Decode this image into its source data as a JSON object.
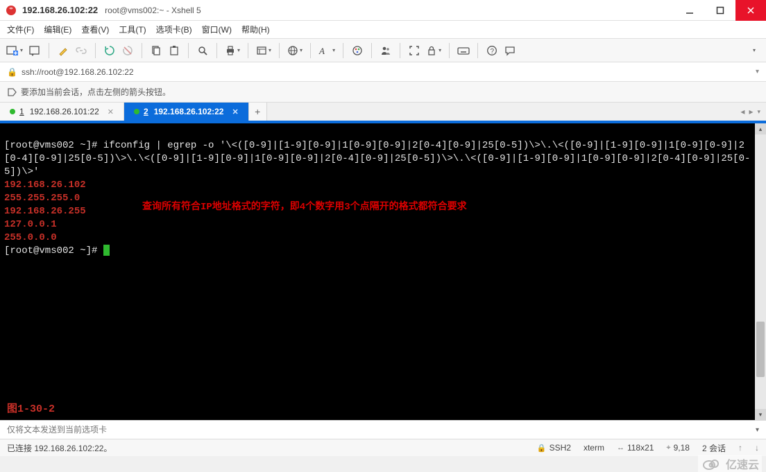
{
  "window": {
    "title_ip": "192.168.26.102:22",
    "subtitle": "root@vms002:~ - Xshell 5"
  },
  "menu": {
    "file": "文件(F)",
    "edit": "编辑(E)",
    "view": "查看(V)",
    "tools": "工具(T)",
    "tabs": "选项卡(B)",
    "window": "窗口(W)",
    "help": "帮助(H)"
  },
  "address": {
    "url": "ssh://root@192.168.26.102:22"
  },
  "hint": {
    "text": "要添加当前会话，点击左侧的箭头按钮。"
  },
  "tabs": [
    {
      "num": "1",
      "label": "192.168.26.101:22",
      "active": false
    },
    {
      "num": "2",
      "label": "192.168.26.102:22",
      "active": true
    }
  ],
  "terminal": {
    "prompt1": "[root@vms002 ~]# ",
    "command": "ifconfig | egrep -o '\\<([0-9]|[1-9][0-9]|1[0-9][0-9]|2[0-4][0-9]|25[0-5])\\>\\.\\<([0-9]|[1-9][0-9]|1[0-9][0-9]|2[0-4][0-9]|25[0-5])\\>\\.\\<([0-9]|[1-9][0-9]|1[0-9][0-9]|2[0-4][0-9]|25[0-5])\\>\\.\\<([0-9]|[1-9][0-9]|1[0-9][0-9]|2[0-4][0-9]|25[0-5])\\>'",
    "outputs": [
      "192.168.26.102",
      "255.255.255.0",
      "192.168.26.255",
      "127.0.0.1",
      "255.0.0.0"
    ],
    "prompt2": "[root@vms002 ~]# ",
    "annotation": "查询所有符合IP地址格式的字符，即4个数字用3个点隔开的格式都符合要求",
    "figure_label": "图1-30-2"
  },
  "sendbar": {
    "placeholder": "仅将文本发送到当前选项卡"
  },
  "status": {
    "connected": "已连接 192.168.26.102:22。",
    "proto": "SSH2",
    "term": "xterm",
    "size": "118x21",
    "cursor": "9,18",
    "sessions": "2 会话"
  },
  "watermark": {
    "text": "亿速云"
  }
}
